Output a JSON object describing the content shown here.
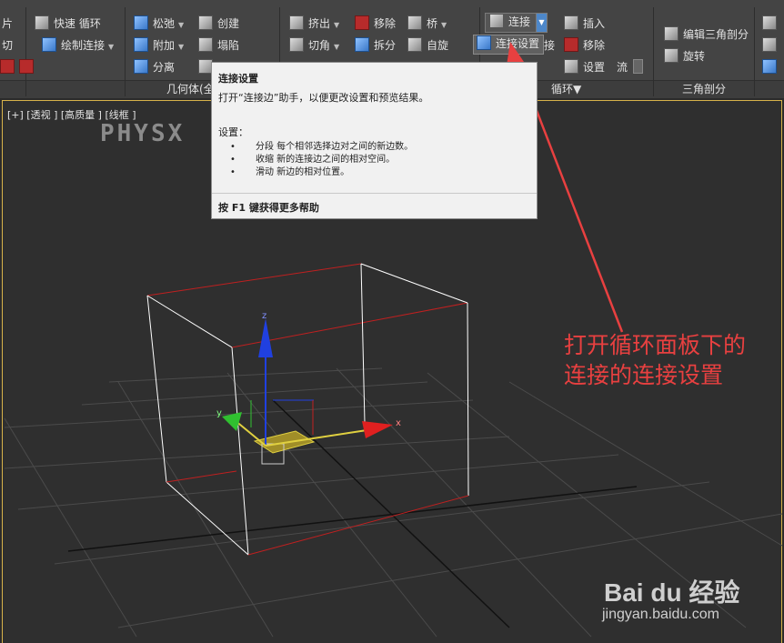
{
  "ribbon": {
    "col0": [
      "片",
      "切"
    ],
    "loop_col": [
      "快速 循环",
      "绘制连接"
    ],
    "geometry": {
      "items": [
        "松弛",
        "附加",
        "分离",
        "创建",
        "塌陷"
      ],
      "title": "几何体(全"
    },
    "edges": {
      "items": [
        "挤出",
        "切角",
        "移除",
        "拆分",
        "桥",
        "自旋"
      ]
    },
    "loops": {
      "connect": "连接",
      "connect_settings": "连接设置",
      "connect_settings_suffix": "接",
      "settings_suffix": "接",
      "insert": "插入",
      "remove": "移除",
      "settings": "设置",
      "flow": "流",
      "title": "循环"
    },
    "tris": {
      "edit_triangulation": "编辑三角剖分",
      "rotate": "旋转",
      "title": "三角剖分"
    }
  },
  "viewport": {
    "label": "[+] [透视 ] [高质量 ] [线框 ]",
    "physx": "PHYSX",
    "axis_x": "x",
    "axis_y": "y",
    "axis_z": "z"
  },
  "tooltip": {
    "title": "连接设置",
    "description": "打开“连接边”助手，以便更改设置和预览结果。",
    "settings_heading": "设置：",
    "items": [
      "分段 每个相邻选择边对之间的新边数。",
      "收缩 新的连接边之间的相对空间。",
      "滑动 新边的相对位置。"
    ],
    "help": "按 F1 键获得更多帮助"
  },
  "annotation": {
    "line1": "打开循环面板下的",
    "line2": "连接的连接设置"
  },
  "watermark": {
    "logo": "Bai du 经验",
    "url": "jingyan.baidu.com"
  },
  "colors": {
    "annotation_red": "#e84040",
    "viewport_border": "#d8b34a",
    "axis_x": "#e02020",
    "axis_y": "#30c030",
    "axis_z": "#2040e0"
  }
}
